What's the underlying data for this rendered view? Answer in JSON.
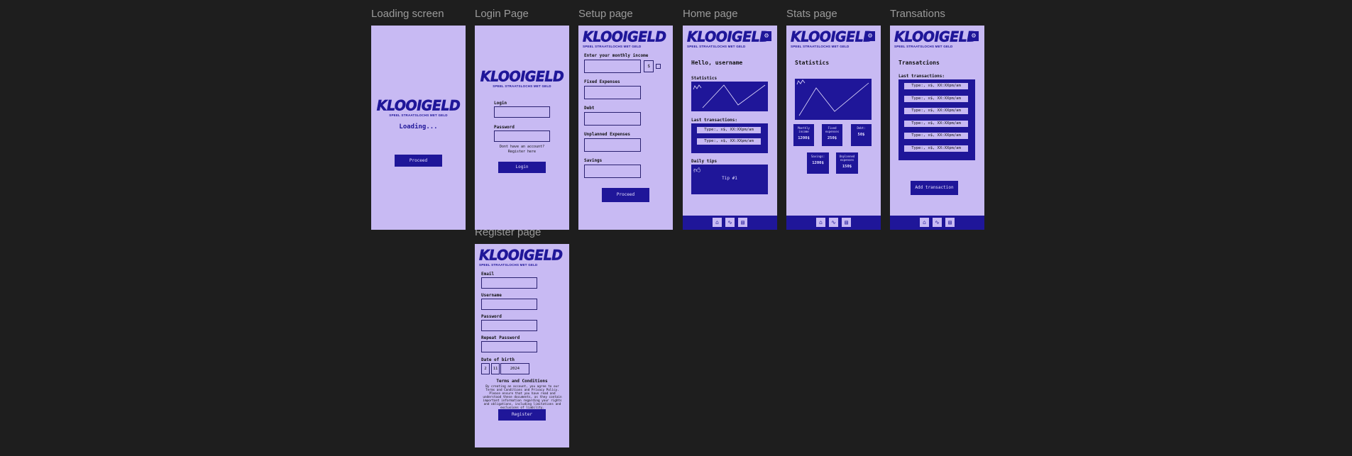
{
  "logo": {
    "word": "KLOOIGELD",
    "tagline": "SPEEL STRAATSLOCHS MET GELD"
  },
  "frames": {
    "loading": {
      "title": "Loading screen",
      "loading_text": "Loading...",
      "button": "Proceed"
    },
    "login": {
      "title": "Login Page",
      "login_label": "Login",
      "password_label": "Password",
      "no_account": "Dont have an account?",
      "register_link": "Register here",
      "button": "Login"
    },
    "setup": {
      "title": "Setup page",
      "income_label": "Enter your monthly income",
      "currency": "$",
      "fixed_label": "Fixed Expenses",
      "debt_label": "Debt",
      "unplanned_label": "Unplanned Expenses",
      "savings_label": "Savings",
      "button": "Proceed"
    },
    "home": {
      "title": "Home page",
      "greeting": "Hello, username",
      "stats_label": "Statistics",
      "last_tx_label": "Last transactions:",
      "transactions": [
        "Type:, x$, XX:XXpm/am",
        "Type:, x$, XX:XXpm/am"
      ],
      "tip_label": "Daily tips",
      "tip_text": "Tip #1"
    },
    "stats": {
      "title": "Stats page",
      "heading": "Statistics",
      "boxes": [
        {
          "label": "Monthly income",
          "value": "1200$"
        },
        {
          "label": "Fixed expenses",
          "value": "250$"
        },
        {
          "label": "Debt:",
          "value": "50$"
        },
        {
          "label": "Savings:",
          "value": "1200$"
        },
        {
          "label": "Unplanned expenses",
          "value": "150$"
        }
      ]
    },
    "transactions": {
      "title": "Transations",
      "heading": "Transatcions",
      "last_tx_label": "Last transactions:",
      "items": [
        "Type:, x$, XX:XXpm/am",
        "Type:, x$, XX:XXpm/am",
        "Type:, x$, XX:XXpm/am",
        "Type:, x$, XX:XXpm/am",
        "Type:, x$, XX:XXpm/am",
        "Type:, x$, XX:XXpm/am"
      ],
      "button": "Add transaction"
    },
    "register": {
      "title": "Register page",
      "email_label": "Email",
      "username_label": "Username",
      "password_label": "Password",
      "repeat_label": "Repeat Password",
      "dob_label": "Date of birth",
      "dob_day": "2",
      "dob_month": "11",
      "dob_year": "2024",
      "terms_heading": "Terms and Conditions",
      "terms_text": "By creating an account, you agree to our Terms and Conditions and Privacy Policy. Please ensure that you have read and understood these documents, as they contain important information regarding your rights and obligations, including limitations and exclusions of liability.",
      "button": "Register"
    }
  },
  "icons": {
    "settings": "gear-icon",
    "home": "home-icon",
    "stats": "stats-icon",
    "transactions": "transactions-icon",
    "thumb": "thumbs-up-icon"
  },
  "colors": {
    "background": "#1e1e1e",
    "frame": "#c8baf3",
    "accent": "#1f1699"
  }
}
